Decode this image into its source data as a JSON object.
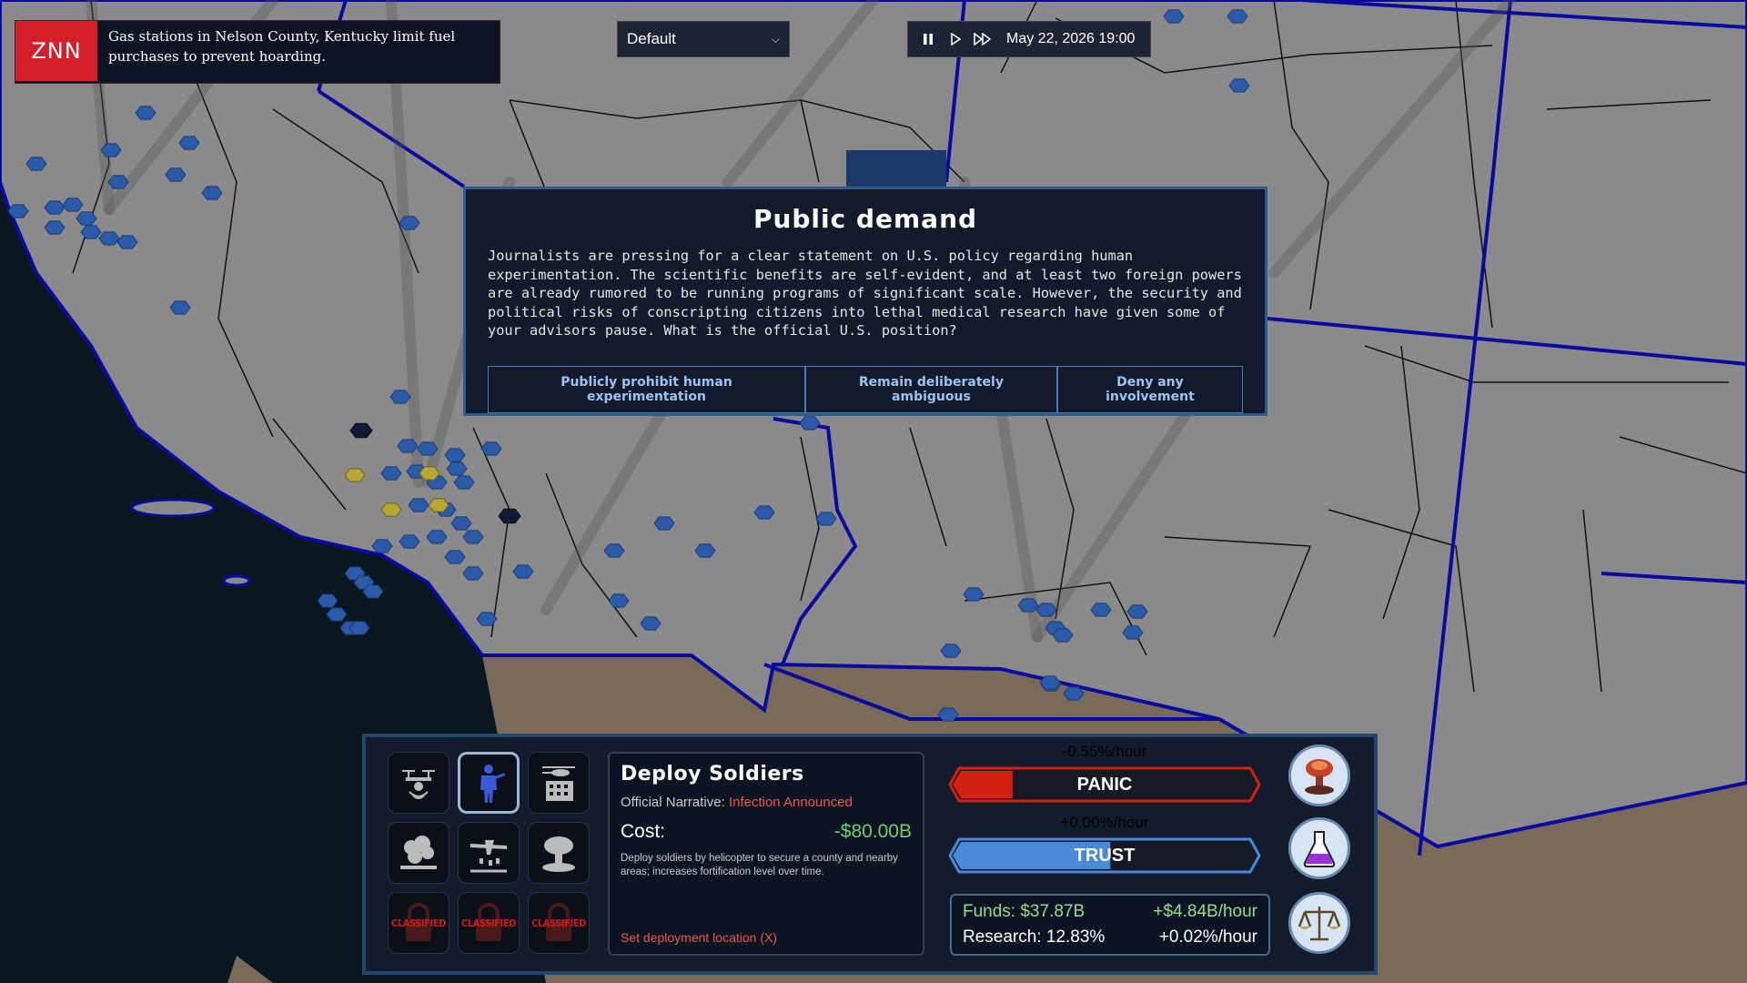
{
  "news": {
    "logo": "ZNN",
    "headline": "Gas stations in Nelson County, Kentucky limit fuel purchases to prevent hoarding."
  },
  "scenario": {
    "selected": "Default"
  },
  "time": {
    "datetime": "May 22, 2026 19:00"
  },
  "event": {
    "title": "Public demand",
    "body": "Journalists are pressing for a clear statement on U.S. policy regarding human experimentation. The scientific benefits are self-evident, and at least two foreign powers are already rumored to be running programs of significant scale. However, the security and political risks of conscripting citizens into lethal medical research have given some of your advisors pause. What is the official U.S. position?",
    "choices": [
      "Publicly prohibit human experimentation",
      "Remain deliberately ambiguous",
      "Deny any involvement"
    ]
  },
  "tools": {
    "locked_label": "CLASSIFIED"
  },
  "action": {
    "title": "Deploy Soldiers",
    "narrative_label": "Official Narrative:",
    "narrative_value": "Infection Announced",
    "cost_label": "Cost:",
    "cost_value": "-$80.00B",
    "description": "Deploy soldiers by helicopter to secure a county and nearby areas; increases fortification level over time.",
    "instruction": "Set deployment location (X)"
  },
  "meters": {
    "panic": {
      "label": "PANIC",
      "rate": "-0.55%/hour",
      "level": 0.18,
      "color": "#d42010"
    },
    "trust": {
      "label": "TRUST",
      "rate": "+0.00%/hour",
      "level": 0.52,
      "color": "#4a88d8"
    }
  },
  "economy": {
    "funds": "Funds: $37.87B",
    "funds_rate": "+$4.84B/hour",
    "research": "Research: 12.83%",
    "research_rate": "+0.02%/hour"
  },
  "colors": {
    "land": "#8a8a8a",
    "ocean": "#0a1620",
    "border": "#0a0aa0",
    "mexico": "#7a6a5a",
    "outbreak": "#2a5aa8",
    "panic_rate": "#ffffff",
    "trust_rate": "#6fa8f0"
  }
}
